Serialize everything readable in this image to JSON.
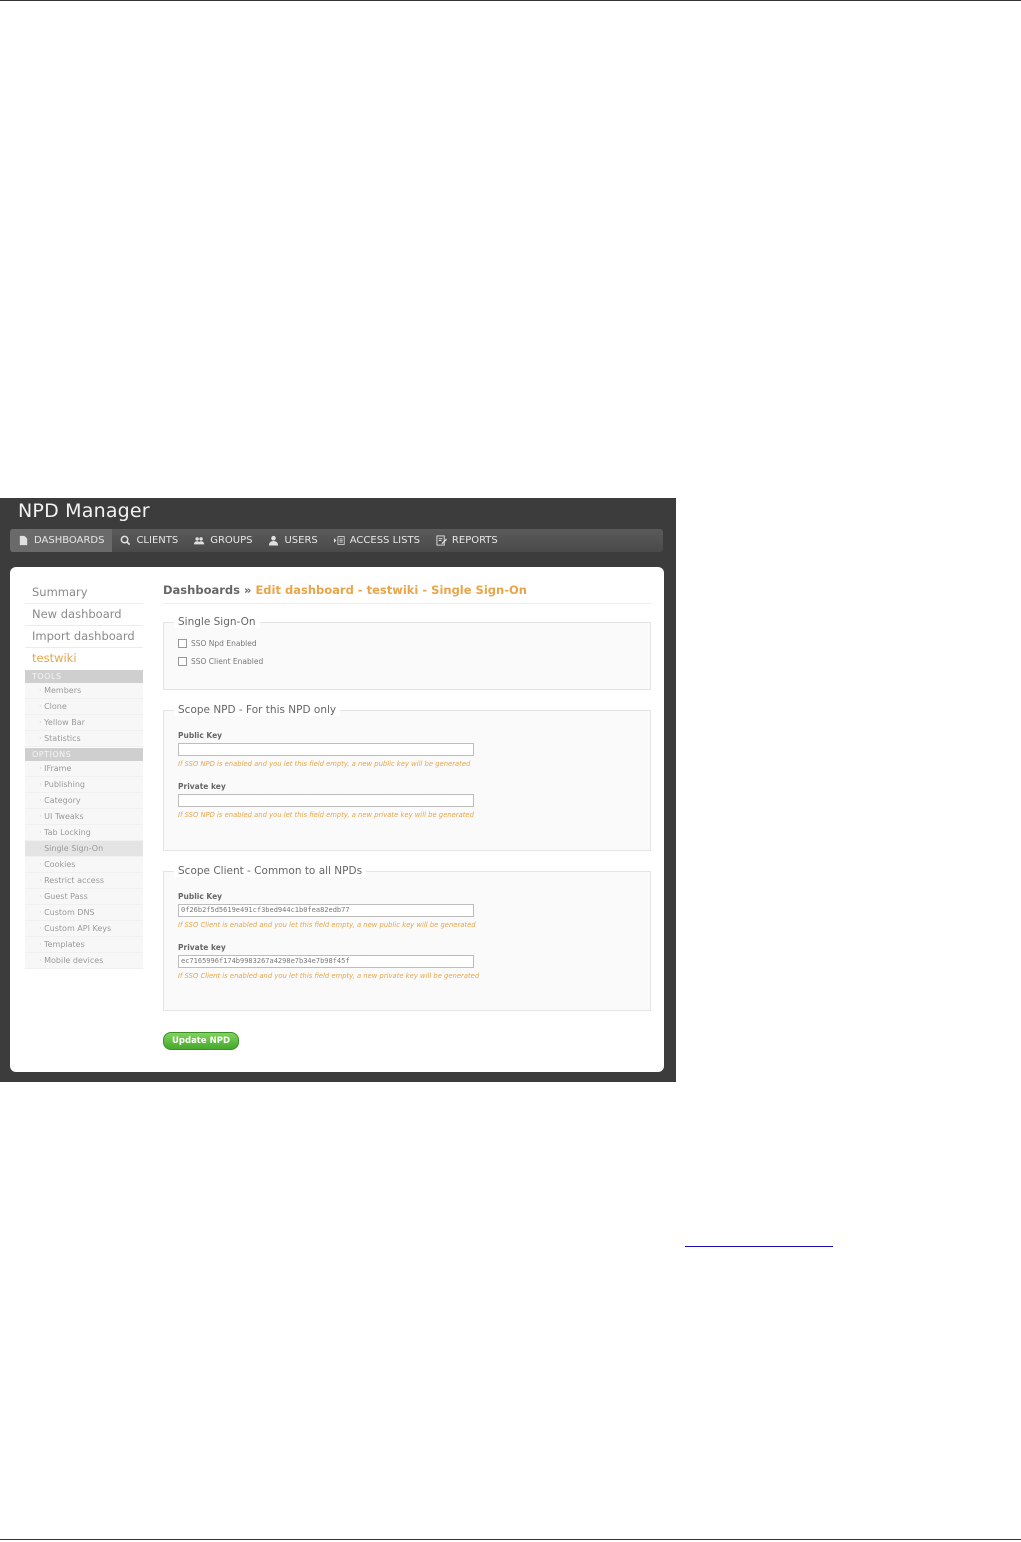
{
  "app": {
    "title": "NPD Manager"
  },
  "nav": [
    {
      "label": "DASHBOARDS",
      "icon": "document-icon"
    },
    {
      "label": "CLIENTS",
      "icon": "search-icon"
    },
    {
      "label": "GROUPS",
      "icon": "group-icon"
    },
    {
      "label": "USERS",
      "icon": "user-icon"
    },
    {
      "label": "ACCESS LISTS",
      "icon": "access-list-icon"
    },
    {
      "label": "REPORTS",
      "icon": "report-icon"
    }
  ],
  "sidebar": {
    "links": [
      "Summary",
      "New dashboard",
      "Import dashboard"
    ],
    "current": "testwiki",
    "tools_header": "TOOLS",
    "tools": [
      "Members",
      "Clone",
      "Yellow Bar",
      "Statistics"
    ],
    "options_header": "OPTIONS",
    "options": [
      "IFrame",
      "Publishing",
      "Category",
      "UI Tweaks",
      "Tab Locking",
      "Single Sign-On",
      "Cookies",
      "Restrict access",
      "Guest Pass",
      "Custom DNS",
      "Custom API Keys",
      "Templates",
      "Mobile devices"
    ]
  },
  "breadcrumb": {
    "root": "Dashboards",
    "separator": "»",
    "current": "Edit dashboard - testwiki - Single Sign-On"
  },
  "sso": {
    "legend": "Single Sign-On",
    "npd_enabled": "SSO Npd Enabled",
    "client_enabled": "SSO Client Enabled"
  },
  "scope_npd": {
    "legend": "Scope NPD - For this NPD only",
    "public_label": "Public Key",
    "public_value": "",
    "public_hint": "If SSO NPD is enabled and you let this field empty, a new public key will be generated",
    "private_label": "Private key",
    "private_value": "",
    "private_hint": "If SSO NPD is enabled and you let this field empty, a new private key will be generated"
  },
  "scope_client": {
    "legend": "Scope Client - Common to all NPDs",
    "public_label": "Public Key",
    "public_value": "0f26b2f5d5619e491cf3bed944c1b0fea82edb77",
    "public_hint": "If SSO Client is enabled and you let this field empty, a new public key will be generated",
    "private_label": "Private key",
    "private_value": "ec7165996f174b9983267a4298e7b34e7b98f45f",
    "private_hint": "If SSO Client is enabled and you let this field empty, a new private key will be generated"
  },
  "update_button": "Update NPD",
  "colors": {
    "accent": "#e8a54a",
    "button": "#45a92b",
    "chrome": "#3c3c3c"
  }
}
